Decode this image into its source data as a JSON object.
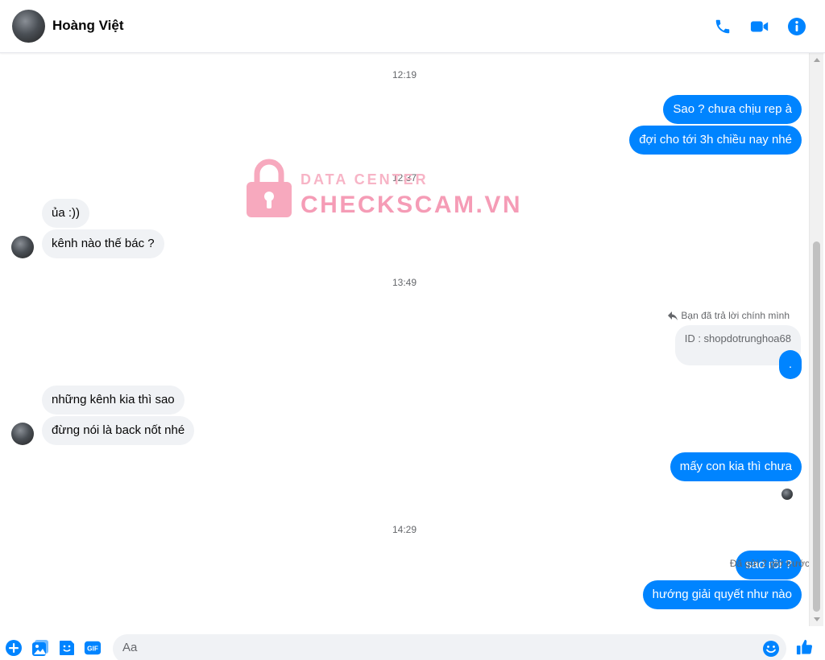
{
  "header": {
    "contact_name": "Hoàng Việt",
    "icons": [
      "phone-icon",
      "video-camera-icon",
      "info-icon"
    ]
  },
  "colors": {
    "accent": "#0084ff",
    "incoming_bubble": "#f0f2f5",
    "timestamp": "#65676b",
    "watermark": "#f59cb6"
  },
  "watermark": {
    "line1": "DATA CENTER",
    "line2": "CHECKSCAM.VN"
  },
  "timestamps": [
    "12:19",
    "12:37",
    "13:49",
    "14:29"
  ],
  "messages": {
    "m1": "Sao ? chưa chịu rep à",
    "m2": "đợi cho tới 3h chiều nay nhé",
    "m3": "ủa :))",
    "m4": "kênh nào thế bác ?",
    "m5": ".",
    "m6": "những kênh kia thì sao",
    "m7": "đừng nói là back nốt nhé",
    "m8": "mấy con kia thì chưa",
    "m9": "sao rồi ?",
    "m10": "hướng giải quyết như nào"
  },
  "reply": {
    "label": "Bạn đã trả lời chính mình",
    "quoted_text": "ID : shopdotrunghoa68"
  },
  "status": {
    "sent": "Đã gửi 2 giờ trước"
  },
  "composer": {
    "placeholder": "Aa",
    "icons": [
      "plus-icon",
      "photo-icon",
      "sticker-icon",
      "gif-icon",
      "emoji-icon",
      "thumbs-up-icon"
    ]
  }
}
